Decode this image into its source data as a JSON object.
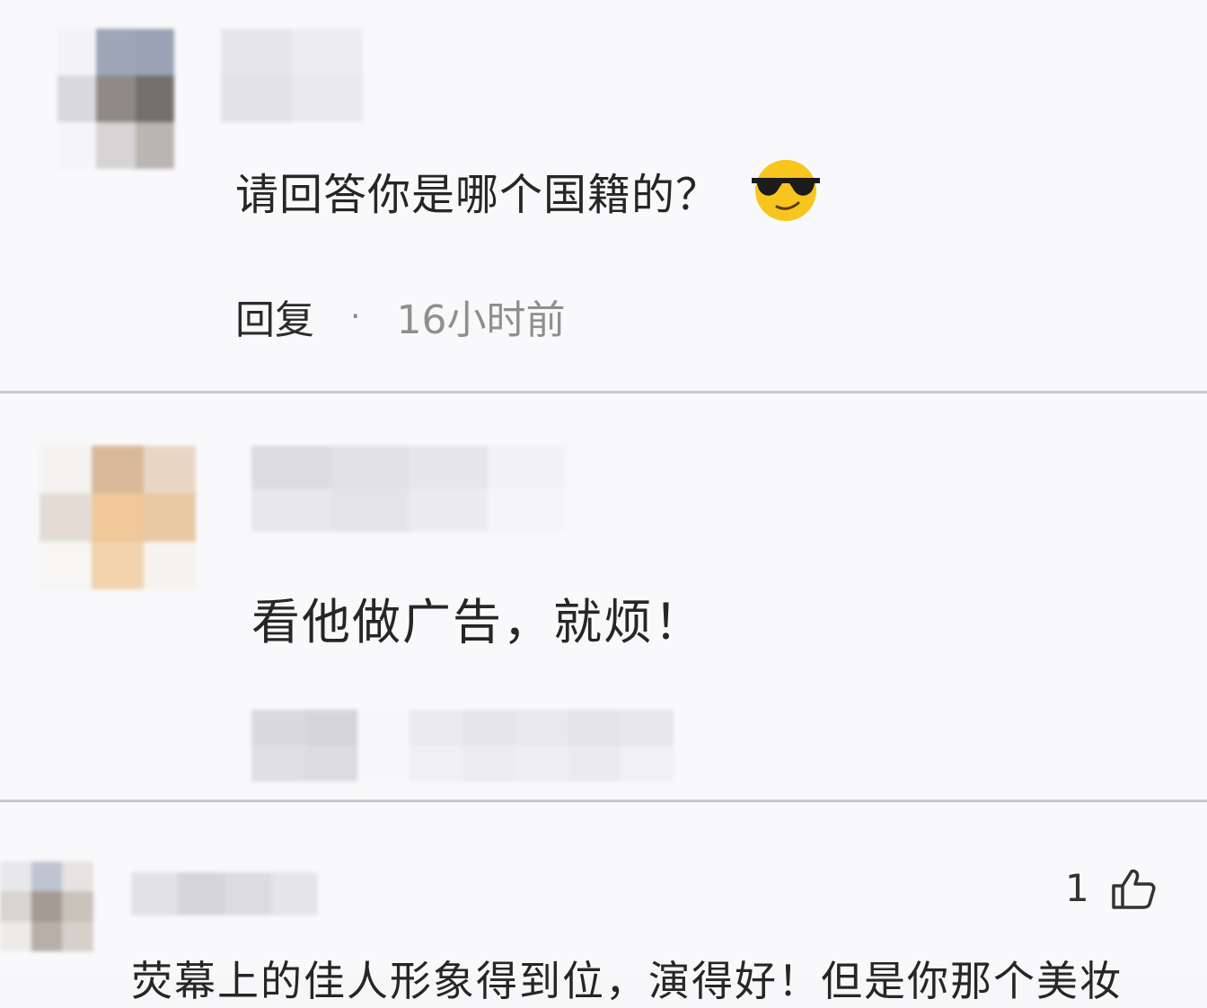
{
  "comments": [
    {
      "text": "请回答你是哪个国籍的？",
      "emoji_icon": "sunglasses-face-emoji",
      "reply_label": "回复",
      "separator": "·",
      "time": "16小时前"
    },
    {
      "text": "看他做广告，就烦！"
    },
    {
      "like_count": "1",
      "like_icon": "thumbs-up-icon",
      "text": "荧幕上的佳人形象得到位，演得好！但是你那个美妆"
    }
  ],
  "colors": {
    "background": "#f9f9fb",
    "divider": "#c9c9cd",
    "text_primary": "#262626",
    "text_secondary": "#8f8f8f",
    "emoji_yellow": "#f7c51e"
  }
}
